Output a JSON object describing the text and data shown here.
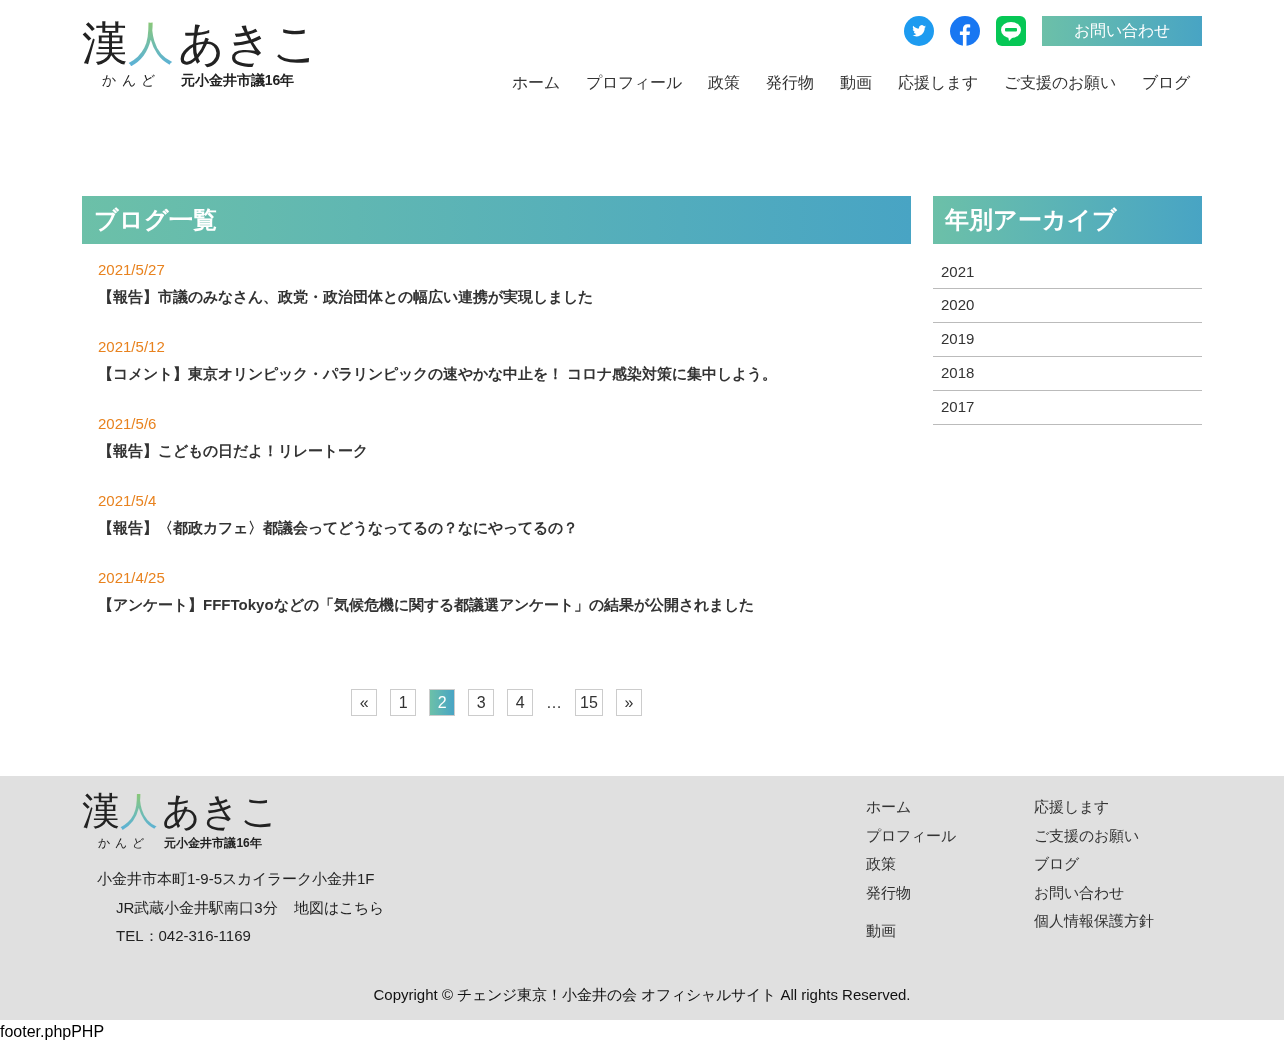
{
  "header": {
    "logo": {
      "main_1": "漢",
      "main_2": "人",
      "main_3": "あきこ",
      "reading": "かんど",
      "subtitle": "元小金井市議16年"
    },
    "contact_button": "お問い合わせ",
    "nav": [
      "ホーム",
      "プロフィール",
      "政策",
      "発行物",
      "動画",
      "応援します",
      "ご支援のお願い",
      "ブログ"
    ]
  },
  "blog": {
    "title": "ブログ一覧",
    "posts": [
      {
        "date": "2021/5/27",
        "title": "【報告】市議のみなさん、政党・政治団体との幅広い連携が実現しました"
      },
      {
        "date": "2021/5/12",
        "title": "【コメント】東京オリンピック・パラリンピックの速やかな中止を！ コロナ感染対策に集中しよう。"
      },
      {
        "date": "2021/5/6",
        "title": "【報告】こどもの日だよ！リレートーク"
      },
      {
        "date": "2021/5/4",
        "title": "【報告】〈都政カフェ〉都議会ってどうなってるの？なにやってるの？"
      },
      {
        "date": "2021/4/25",
        "title": "【アンケート】FFFTokyoなどの「気候危機に関する都議選アンケート」の結果が公開されました"
      }
    ]
  },
  "pagination": [
    {
      "kind": "page",
      "label": "«",
      "selected": false
    },
    {
      "kind": "page",
      "label": "1",
      "selected": false
    },
    {
      "kind": "page",
      "label": "2",
      "selected": true
    },
    {
      "kind": "page",
      "label": "3",
      "selected": false
    },
    {
      "kind": "page",
      "label": "4",
      "selected": false
    },
    {
      "kind": "ellipsis",
      "label": "…"
    },
    {
      "kind": "page",
      "label": "15",
      "selected": false
    },
    {
      "kind": "page",
      "label": "»",
      "selected": false
    }
  ],
  "archive": {
    "title": "年別アーカイブ",
    "years": [
      "2021",
      "2020",
      "2019",
      "2018",
      "2017"
    ]
  },
  "footer": {
    "logo": {
      "main_1": "漢",
      "main_2": "人",
      "main_3": "あきこ",
      "reading": "かんど",
      "subtitle": "元小金井市議16年"
    },
    "address": "小金井市本町1-9-5スカイラーク小金井1F",
    "access": "JR武蔵小金井駅南口3分",
    "map_link": "地図はこちら",
    "tel": "TEL：042-316-1169",
    "nav_columns": [
      [
        [
          "ホーム",
          "プロフィール",
          "政策",
          "発行物"
        ],
        [
          "動画"
        ]
      ],
      [
        [
          "応援します",
          "ご支援のお願い",
          "ブログ",
          "お問い合わせ",
          "個人情報保護方針"
        ]
      ]
    ],
    "copyright": "Copyright © チェンジ東京！小金井の会 オフィシャルサイト All rights Reserved."
  },
  "debug_text": "footer.phpPHP"
}
